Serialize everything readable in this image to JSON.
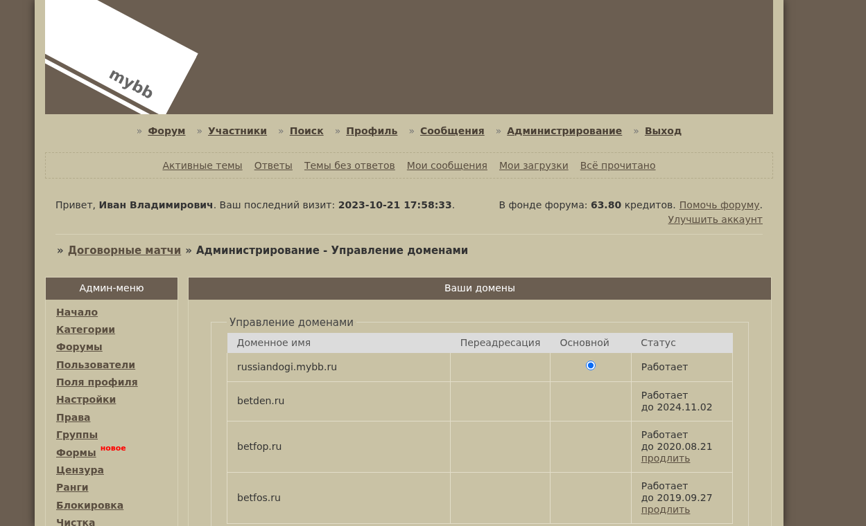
{
  "logo": {
    "text": "mybb"
  },
  "nav": [
    {
      "label": "Форум"
    },
    {
      "label": "Участники"
    },
    {
      "label": "Поиск"
    },
    {
      "label": "Профиль"
    },
    {
      "label": "Сообщения"
    },
    {
      "label": "Администрирование"
    },
    {
      "label": "Выход"
    }
  ],
  "nav_marker": "»",
  "subnav": [
    "Активные темы",
    "Ответы",
    "Темы без ответов",
    "Мои сообщения",
    "Мои загрузки",
    "Всё прочитано"
  ],
  "welcome": {
    "text": "Привет, **Иван Владимирович**.  Ваш последний визит: **2023-10-21 17:58:33**."
  },
  "fund": {
    "text": "В фонде форума: **63.80** кредитов.",
    "help_link": "Помочь форуму",
    "help_suffix": ".",
    "upgrade_link": "Улучшить аккаунт"
  },
  "breadcrumb": [
    {
      "marker": "»",
      "label": "Договорные матчи",
      "link": true
    },
    {
      "marker": "»",
      "label": "Администрирование - Управление доменами",
      "link": false
    }
  ],
  "sidebar": {
    "title": "Админ-меню",
    "items": [
      {
        "label": "Начало"
      },
      {
        "label": "Категории"
      },
      {
        "label": "Форумы"
      },
      {
        "label": "Пользователи"
      },
      {
        "label": "Поля профиля"
      },
      {
        "label": "Настройки"
      },
      {
        "label": "Права"
      },
      {
        "label": "Группы"
      },
      {
        "label": "Формы",
        "badge": "новое"
      },
      {
        "label": "Цензура"
      },
      {
        "label": "Ранги"
      },
      {
        "label": "Блокировка"
      },
      {
        "label": "Чистка"
      }
    ]
  },
  "main": {
    "title": "Ваши домены",
    "fieldset_legend": "Управление доменами",
    "table": {
      "columns": [
        "Доменное имя",
        "Переадресация",
        "Основной",
        "Статус"
      ],
      "rows": [
        {
          "domain": "russiandogi.mybb.ru",
          "primary": true,
          "status": "Работает"
        },
        {
          "domain": "betden.ru",
          "status": "Работает",
          "until": "до 2024.11.02"
        },
        {
          "domain": "betfop.ru",
          "status": "Работает",
          "until": "до 2020.08.21",
          "renew": "продлить"
        },
        {
          "domain": "betfos.ru",
          "status": "Работает",
          "until": "до 2019.09.27",
          "renew": "продлить"
        }
      ]
    }
  }
}
